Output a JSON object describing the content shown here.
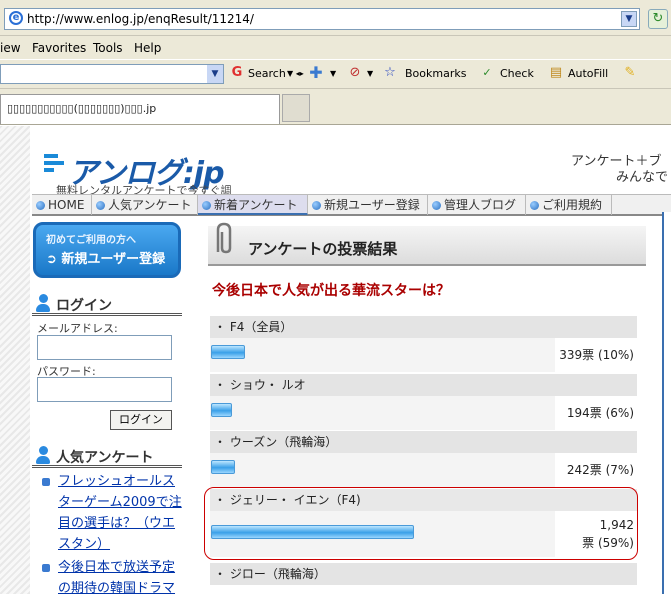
{
  "browser": {
    "url": "http://www.enlog.jp/enqResult/11214/",
    "menu": [
      "iew",
      "Favorites",
      "Tools",
      "Help"
    ],
    "toolbar": {
      "search_label": "Search",
      "bookmarks_label": "Bookmarks",
      "check_label": "Check",
      "autofill_label": "AutoFill"
    },
    "tab_title": "▯▯▯▯▯▯▯▯▯▯▯(▯▯▯▯▯▯▯)▯▯▯.jp"
  },
  "site": {
    "logo_text": "アンログ",
    "logo_suffix": ":jp",
    "tagline": "無料レンタルアンケートで今すぐ調",
    "slogan1": "アンケート＋ブ",
    "slogan2": "みんなで"
  },
  "nav": [
    "HOME",
    "人気アンケート",
    "新着アンケート",
    "新規ユーザー登録",
    "管理人ブログ",
    "ご利用規約"
  ],
  "sidebar": {
    "reg_line1": "初めてご利用の方へ",
    "reg_line2": "新規ユーザー登録",
    "login_title": "ログイン",
    "email_label": "メールアドレス:",
    "password_label": "パスワード:",
    "login_button": "ログイン",
    "popular_title": "人気アンケート",
    "popular": [
      "フレッシュオールスターゲーム2009で注目の選手は？（ウエスタン）",
      "今後日本で放送予定の期待の韓国ドラマ"
    ]
  },
  "result": {
    "title": "アンケートの投票結果",
    "question": "今後日本で人気が出る華流スターは？",
    "options": [
      {
        "label": "・ F4（全員）",
        "votes": "339票 (10%)",
        "percent": 10
      },
      {
        "label": "・ ショウ・ ルオ",
        "votes": "194票 (6%)",
        "percent": 6
      },
      {
        "label": "・ ウーズン（飛輪海）",
        "votes": "242票 (7%)",
        "percent": 7
      },
      {
        "label": "・ ジェリー・ イエン（F4)",
        "votes_line1": "1,942",
        "votes_line2": "票 (59%)",
        "percent": 59
      },
      {
        "label": "・ ジロー（飛輪海）"
      }
    ]
  },
  "colors": {
    "accent": "#1a6ab8",
    "question": "#aa0000",
    "selected_outline": "#cc0000"
  }
}
